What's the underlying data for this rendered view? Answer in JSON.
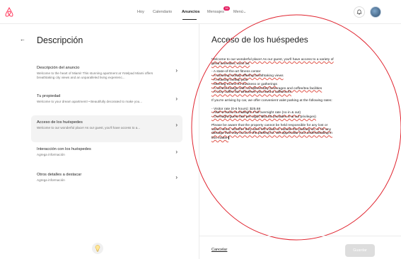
{
  "nav": {
    "links": [
      "Hoy",
      "Calendario",
      "Anuncios",
      "Mensajes",
      "Menú"
    ],
    "active": "Anuncios",
    "messages_badge": "39",
    "brand_color": "#FF385C"
  },
  "left": {
    "title": "Descripción",
    "items": [
      {
        "title": "Descripción del anuncio",
        "desc": "Welcome to the heart of Miami! This stunning apartment at Yotelpad Miami offers breathtaking city views and an unparalleled living experienc..."
      },
      {
        "title": "Tu propiedad",
        "desc": "Welcome to your dream apartment! • Beautifully decorated to make you..."
      },
      {
        "title": "Acceso de los huéspedes",
        "desc": "Welcome to our wonderful place! As our guest, you'll have access to a..."
      },
      {
        "title": "Interacción con los huéspedes",
        "desc": "Agrega información"
      },
      {
        "title": "Otros detalles a destacar",
        "desc": "Agrega información"
      }
    ],
    "active_index": 2
  },
  "right": {
    "title": "Acceso de los huéspedes",
    "lines": [
      "Welcome to our wonderful place! As our guest, you'll have access to a variety of",
      "great amenities, such as:",
      "- A state-of-the-art fitness center",
      "- A stunning rooftop offering breathtaking views",
      "- A relaxing rooftop pool",
      "- Meeting rooms for business or gatherings",
      "- A central lounge with complimentary beverages and coffee/tea facilities",
      "- A cozy coffee bar whenever you need a caffeine fix",
      "If you're arriving by car, we offer convenient valet parking at the following rates:",
      "- Visitor rate (0-6 hours): $25.68",
      "- After 6 hours or midnight: Full overnight rate (no in & out)",
      "- Overnight guest rate per night: $53.50 (includes in & out privileges)",
      "Please be aware that the property cannot be held responsible for any lost or",
      "stolen items, whether they were left inside or outside the parking lot, or for any",
      "damage that may occur in the parking lot. We appreciate your understanding in",
      "this matter."
    ],
    "cancel_label": "Cancelar",
    "save_label": "Guardar",
    "annotation_color": "#e0232e"
  }
}
